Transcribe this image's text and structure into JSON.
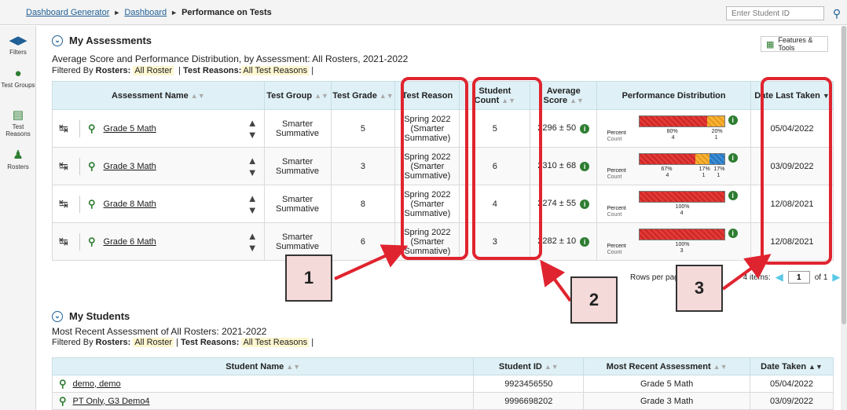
{
  "breadcrumb": {
    "items": [
      "Dashboard Generator",
      "Dashboard"
    ],
    "current": "Performance on Tests"
  },
  "search": {
    "placeholder": "Enter Student ID"
  },
  "sidebar": {
    "items": [
      {
        "label": "Filters",
        "icon": "filter-icon"
      },
      {
        "label": "Test Groups",
        "icon": "test-groups-icon"
      },
      {
        "label": "Test Reasons",
        "icon": "test-reasons-icon"
      },
      {
        "label": "Rosters",
        "icon": "rosters-icon"
      }
    ]
  },
  "assessments": {
    "title": "My Assessments",
    "subtitle": "Average Score and Performance Distribution, by Assessment: All Rosters, 2021-2022",
    "filter_prefix": "Filtered By",
    "filter_rosters_label": "Rosters:",
    "filter_rosters_value": "All Roster",
    "filter_reasons_label": "Test Reasons:",
    "filter_reasons_value": "All Test Reasons",
    "features_label": "Features & Tools",
    "columns": [
      "Assessment Name",
      "Test Group",
      "Test Grade",
      "Test Reason",
      "Student Count",
      "Average Score",
      "Performance Distribution",
      "Date Last Taken"
    ],
    "rows": [
      {
        "name": "Grade 5 Math",
        "group": "Smarter Summative",
        "grade": "5",
        "reason": "Spring 2022 (Smarter Summative)",
        "count": "5",
        "avg": "2296 ± 50",
        "pct_red": "80%",
        "pct_orange": "20%",
        "pct_blue": "",
        "cnt_red": "4",
        "cnt_orange": "1",
        "cnt_blue": "",
        "dist": [
          0.8,
          0.2,
          0
        ],
        "date": "05/04/2022"
      },
      {
        "name": "Grade 3 Math",
        "group": "Smarter Summative",
        "grade": "3",
        "reason": "Spring 2022 (Smarter Summative)",
        "count": "6",
        "avg": "2310 ± 68",
        "pct_red": "67%",
        "pct_orange": "17%",
        "pct_blue": "17%",
        "cnt_red": "4",
        "cnt_orange": "1",
        "cnt_blue": "1",
        "dist": [
          0.67,
          0.17,
          0.17
        ],
        "date": "03/09/2022"
      },
      {
        "name": "Grade 8 Math",
        "group": "Smarter Summative",
        "grade": "8",
        "reason": "Spring 2022 (Smarter Summative)",
        "count": "4",
        "avg": "2274 ± 55",
        "pct_red": "100%",
        "pct_orange": "",
        "pct_blue": "",
        "cnt_red": "4",
        "cnt_orange": "",
        "cnt_blue": "",
        "dist": [
          1,
          0,
          0
        ],
        "date": "12/08/2021"
      },
      {
        "name": "Grade 6 Math",
        "group": "Smarter Summative",
        "grade": "6",
        "reason": "Spring 2022 (Smarter Summative)",
        "count": "3",
        "avg": "2282 ± 10",
        "pct_red": "100%",
        "pct_orange": "",
        "pct_blue": "",
        "cnt_red": "3",
        "cnt_orange": "",
        "cnt_blue": "",
        "dist": [
          1,
          0,
          0
        ],
        "date": "12/08/2021"
      }
    ],
    "percent_label": "Percent",
    "count_label": "Count",
    "pager": {
      "rows_per_page": "Rows per pag",
      "items": "4 items:",
      "page": "1",
      "of": "of 1"
    }
  },
  "students": {
    "title": "My Students",
    "subtitle": "Most Recent Assessment of All Rosters: 2021-2022",
    "filter_prefix": "Filtered By",
    "filter_rosters_label": "Rosters:",
    "filter_rosters_value": "All Roster",
    "filter_reasons_label": "Test Reasons:",
    "filter_reasons_value": "All Test Reasons",
    "columns": [
      "Student Name",
      "Student ID",
      "Most Recent Assessment",
      "Date Taken"
    ],
    "rows": [
      {
        "name": "demo, demo",
        "id": "9923456550",
        "assessment": "Grade 5 Math",
        "date": "05/04/2022"
      },
      {
        "name": "PT Only, G3 Demo4",
        "id": "9996698202",
        "assessment": "Grade 3 Math",
        "date": "03/09/2022"
      }
    ]
  },
  "callouts": [
    "1",
    "2",
    "3"
  ],
  "colors": {
    "highlight": "#e0242f",
    "header_bg": "#dff1f7",
    "level1": "#e53935",
    "level2": "#f9b233",
    "level3": "#3a8fd8"
  }
}
